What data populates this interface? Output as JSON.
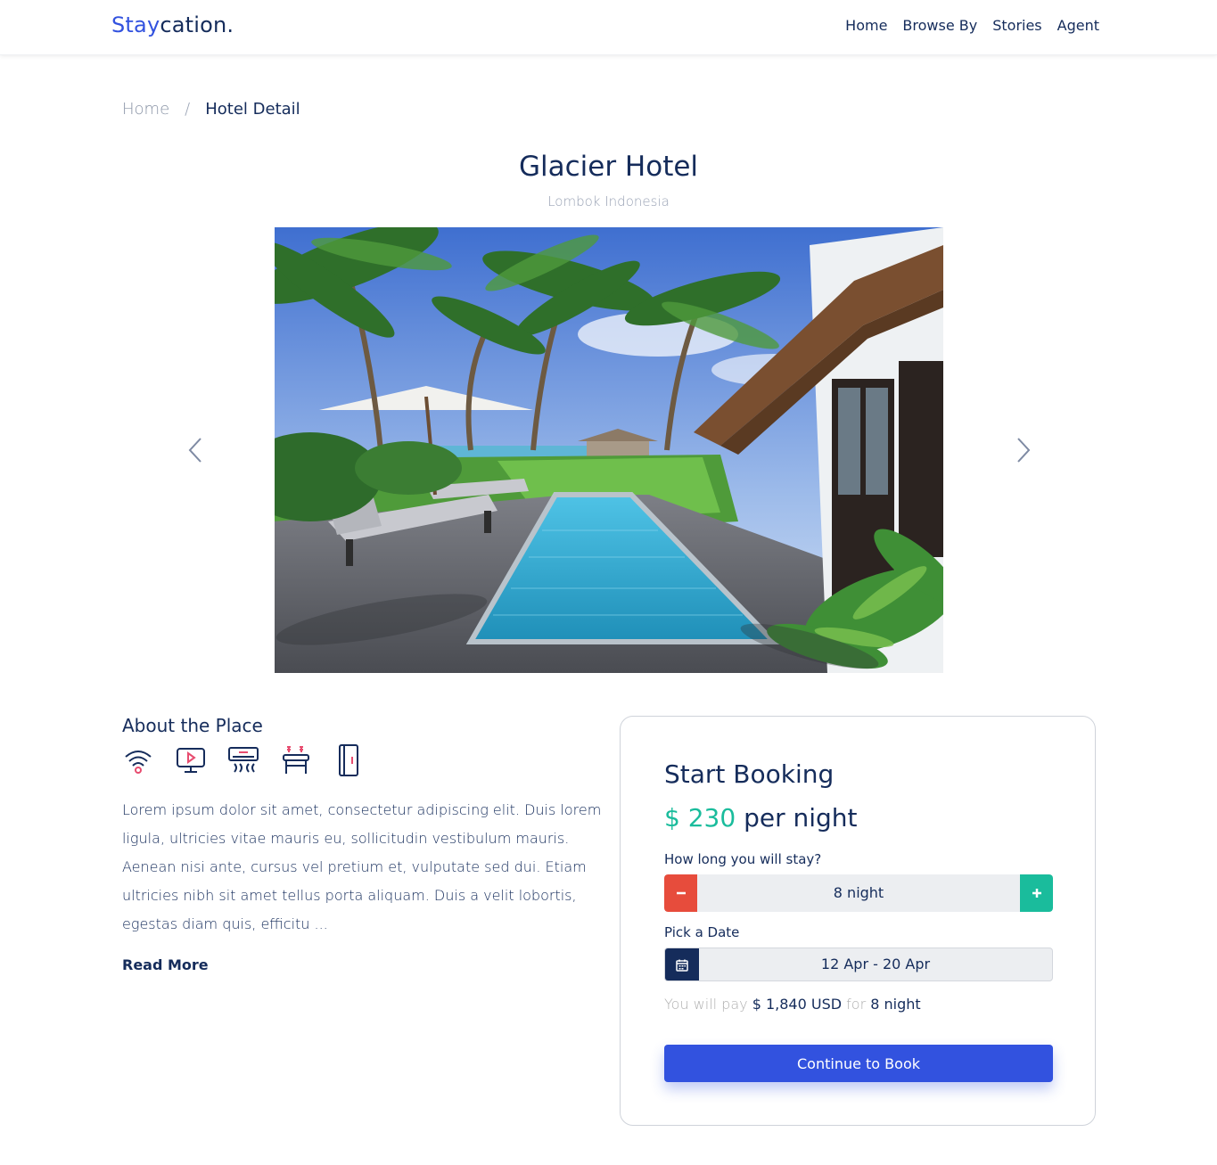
{
  "brand": {
    "part1": "Stay",
    "part2": "cation."
  },
  "nav": {
    "items": [
      "Home",
      "Browse By",
      "Stories",
      "Agent"
    ]
  },
  "breadcrumb": {
    "home": "Home",
    "separator": "/",
    "current": "Hotel Detail"
  },
  "hotel": {
    "name": "Glacier Hotel",
    "location": "Lombok Indonesia"
  },
  "gallery": {
    "prev_icon": "chevron-left-icon",
    "next_icon": "chevron-right-icon"
  },
  "about": {
    "title": "About the Place",
    "amenities": [
      "wifi-icon",
      "tv-icon",
      "air-conditioner-icon",
      "dining-table-icon",
      "refrigerator-icon"
    ],
    "text": "Lorem ipsum dolor sit amet, consectetur adipiscing elit. Duis lorem ligula, ultricies vitae mauris eu, sollicitudin vestibulum mauris. Aenean nisi ante, cursus vel pretium et, vulputate sed dui. Etiam ultricies nibh sit amet tellus porta aliquam. Duis a velit lobortis, egestas diam quis, efficitu ...",
    "read_more": "Read More"
  },
  "booking": {
    "title": "Start Booking",
    "price": "$ 230",
    "price_unit": "per night",
    "stay_label": "How long you will stay?",
    "duration": "8 night",
    "date_label": "Pick a Date",
    "date_range": "12 Apr - 20 Apr",
    "pay_prefix": "You will pay",
    "pay_amount": "$ 1,840 USD",
    "pay_for": "for",
    "pay_nights": "8 night",
    "button": "Continue to Book"
  },
  "colors": {
    "primary": "#3252DF",
    "navy": "#152C5B",
    "green": "#1ABC9C",
    "red": "#E74C3C",
    "muted": "#B0B0B0"
  }
}
